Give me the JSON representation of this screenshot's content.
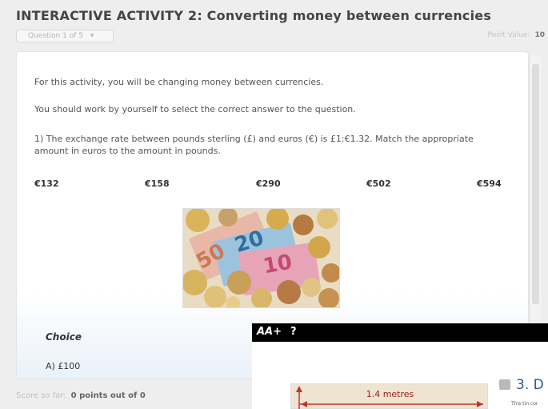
{
  "header": {
    "title": "INTERACTIVE ACTIVITY 2: Converting money between currencies",
    "question_select": "Question 1 of 5",
    "point_value_label": "Point Value:",
    "point_value": "10"
  },
  "content": {
    "intro": "For this activity, you will be changing money between currencies.",
    "instruction": "You should work by yourself to select the correct answer to the question.",
    "question": "1) The exchange rate between pounds sterling (£) and euros (€) is £1:€1.32. Match the appropriate amount in euros to the amount in pounds.",
    "options": [
      "€132",
      "€158",
      "€290",
      "€502",
      "€594"
    ],
    "choice_header": "Choice",
    "choice_a": "A) £100"
  },
  "footer": {
    "score_label": "Score so far:",
    "score_value": "0 points out of 0"
  },
  "overlay": {
    "text_size_button": "AA+",
    "help_button": "?",
    "measure_label": "1.4 metres",
    "section_heading": "3. D",
    "small_text": "This tin cor"
  },
  "colors": {
    "accent_blue": "#2c5a8f",
    "arrow_red": "#c0392b",
    "toolbar_black": "#000000"
  }
}
